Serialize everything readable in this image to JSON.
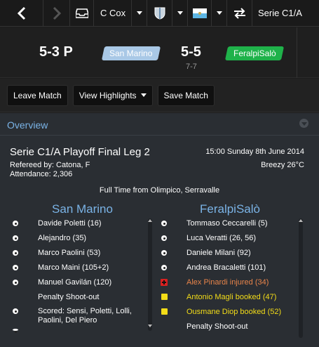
{
  "topbar": {
    "manager": "C Cox",
    "competition": "Serie C1/A"
  },
  "header": {
    "home_score": "5-3 P",
    "home_team": "San Marino",
    "away_score": "5-5",
    "aggregate": "7-7",
    "away_team": "FeralpiSalò",
    "colors": {
      "home_badge": "#a9c8e6",
      "away_badge": "#1fb24a"
    }
  },
  "actions": {
    "leave": "Leave Match",
    "highlights": "View Highlights",
    "save": "Save Match"
  },
  "panel": {
    "title": "Overview",
    "match_title": "Serie C1/A Playoff Final Leg 2",
    "kickoff": "15:00 Sunday 8th June 2014",
    "referee": "Refereed by: Catona, F",
    "attendance": "Attendance: 2,306",
    "weather": "Breezy 26°C",
    "full_time": "Full Time from Olimpico, Serravalle",
    "home_name": "San Marino",
    "away_name": "FeralpiSalò",
    "home_events": [
      {
        "icon": "goal",
        "text": "Davide Poletti (16)"
      },
      {
        "icon": "goal",
        "text": "Alejandro (35)"
      },
      {
        "icon": "goal",
        "text": "Marco Paolini (53)"
      },
      {
        "icon": "goal",
        "text": "Marco Maini (105+2)"
      },
      {
        "icon": "goal",
        "text": "Manuel Gavilán (120)"
      },
      {
        "icon": "none",
        "text": "Penalty Shoot-out"
      },
      {
        "icon": "goal",
        "text": "Scored: Sensi, Poletti, Lolli, Paolini, Del Piero"
      }
    ],
    "away_events": [
      {
        "icon": "goal",
        "text": "Tommaso Ceccarelli (5)"
      },
      {
        "icon": "goal",
        "text": "Luca Veratti (26, 56)"
      },
      {
        "icon": "goal",
        "text": "Daniele Milani (92)"
      },
      {
        "icon": "goal",
        "text": "Andrea Bracaletti (101)"
      },
      {
        "icon": "injury",
        "text": "Alex Pinardi injured (34)"
      },
      {
        "icon": "yellow",
        "text": "Antonio Magli booked (47)"
      },
      {
        "icon": "yellow",
        "text": "Ousmane Diop booked (52)"
      },
      {
        "icon": "none",
        "text": "Penalty Shoot-out"
      }
    ],
    "colors": {
      "accent": "#7ab3e6",
      "injury_text": "#e8844a",
      "booking_text": "#f3dc18"
    }
  }
}
